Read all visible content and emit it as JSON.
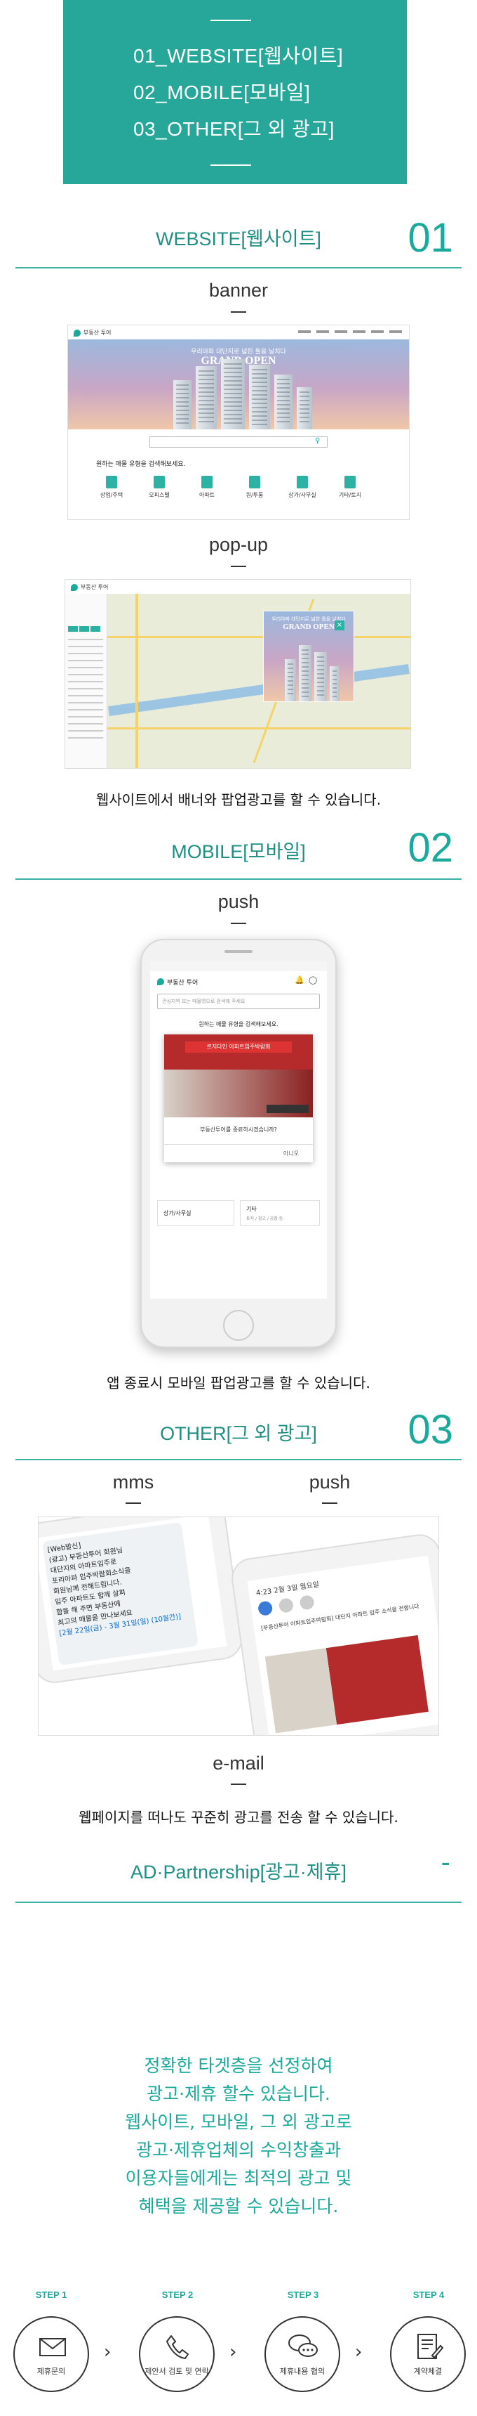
{
  "toc": {
    "items": [
      "01_WEBSITE[웹사이트]",
      "02_MOBILE[모바일]",
      "03_OTHER[그 외 광고]"
    ]
  },
  "website": {
    "title": "WEBSITE[웹사이트]",
    "number": "01",
    "banner_label": "banner",
    "popup_label": "pop-up",
    "desc": "웹사이트에서 배너와 팝업광고를 할 수 있습니다.",
    "mock": {
      "logo": "부동산 투어",
      "hero_small": "우리아파 대단지로 넓힌 틀을 날치다",
      "hero_big": "GRAND OPEN",
      "search_prompt": "원하는 매물 유형을 검색해보세요.",
      "tiles": [
        "상업/주택",
        "오피스텔",
        "아파트",
        "원/투룸",
        "상가/사무실",
        "기타/토지"
      ]
    }
  },
  "mobile": {
    "title": "MOBILE[모바일]",
    "number": "02",
    "push_label": "push",
    "desc": "앱 종료시 모바일 팝업광고를 할 수 있습니다.",
    "mock": {
      "logo": "부동산 투어",
      "search_placeholder": "관심지역 또는 매물명으로 검색해 주세요",
      "prompt": "원하는 매물 유형을 검색해보세요.",
      "popup_title": "르지다인 아파트입주박람회",
      "popup_question": "부동산투어를 종료하시겠습니까?",
      "popup_cancel": "아니오",
      "tile_a": "상가/사무실",
      "tile_b": "기타",
      "tile_b_sub": "토지 / 창고 / 공장 등"
    }
  },
  "other": {
    "title": "OTHER[그 외 광고]",
    "number": "03",
    "mms_label": "mms",
    "push_label": "push",
    "email_label": "e-mail",
    "desc": "웹페이지를 떠나도 꾸준히 광고를 전송 할 수 있습니다.",
    "mms_text": [
      "[Web발신]",
      "(광고) 부동산투어 회원님",
      "대단지의 아파트입주로",
      "포리아파 입주박람회소식을",
      "회원님께 전해드립니다.",
      "입주 아파트도 함께 살펴",
      "함을 해 주면 부동산에",
      "최고의 매물을 만나보세요"
    ],
    "mms_date": "[2월 22일(금) - 3월 31일(일) (10월간)]",
    "push_date": "4:23  2월 3일 월요일",
    "push_text": "[부동산투어 아파트입주박람회] 대단지 아파트 입주 소식을 전합니다"
  },
  "partnership": {
    "title": "AD·Partnership[광고·제휴]",
    "toggle": "-",
    "lines": [
      "정확한 타겟층을 선정하여",
      "광고·제휴 할수 있습니다.",
      "웹사이트, 모바일, 그 외 광고로",
      "광고·제휴업체의 수익창출과",
      "이용자들에게는 최적의 광고 및",
      "혜택을 제공할 수 있습니다."
    ],
    "steps": [
      {
        "label": "STEP 1",
        "caption": "제휴문의",
        "icon": "envelope-icon"
      },
      {
        "label": "STEP 2",
        "caption": "제안서 검토 및 연락",
        "icon": "phone-icon"
      },
      {
        "label": "STEP 3",
        "caption": "제휴내용 협의",
        "icon": "chat-icon"
      },
      {
        "label": "STEP 4",
        "caption": "계약체결",
        "icon": "contract-icon"
      }
    ]
  },
  "colors": {
    "accent": "#1aa99a",
    "toc_bg": "#26a79a"
  }
}
